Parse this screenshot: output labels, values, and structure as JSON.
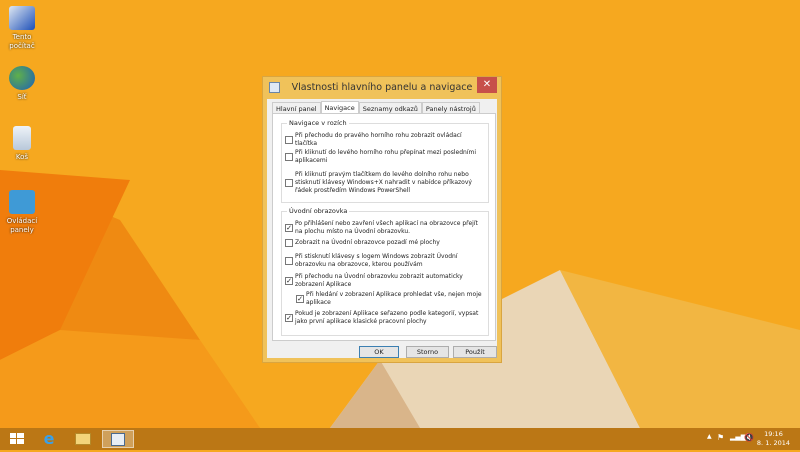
{
  "desktop": {
    "icons": [
      {
        "label": "Tento počítač",
        "icon": "computer-icon"
      },
      {
        "label": "Síť",
        "icon": "network-icon"
      },
      {
        "label": "Koš",
        "icon": "recycle-bin-icon"
      },
      {
        "label": "Ovládací panely",
        "icon": "control-panel-icon"
      }
    ]
  },
  "dialog": {
    "title": "Vlastnosti hlavního panelu a navigace",
    "close": "✕",
    "tabs": [
      "Hlavní panel",
      "Navigace",
      "Seznamy odkazů",
      "Panely nástrojů"
    ],
    "active_tab": "Navigace",
    "groups": [
      {
        "label": "Navigace v rozích",
        "options": [
          {
            "text": "Při přechodu do pravého horního rohu zobrazit ovládací tlačítka",
            "checked": false
          },
          {
            "text": "Při kliknutí do levého horního rohu přepínat mezi posledními aplikacemi",
            "checked": false
          },
          {
            "text": "Při kliknutí pravým tlačítkem do levého dolního rohu nebo stisknutí klávesy Windows+X nahradit v nabídce příkazový řádek prostředím Windows PowerShell",
            "checked": false
          }
        ]
      },
      {
        "label": "Úvodní obrazovka",
        "options": [
          {
            "text": "Po přihlášení nebo zavření všech aplikací na obrazovce přejít na plochu místo na Úvodní obrazovku.",
            "checked": true
          },
          {
            "text": "Zobrazit na Úvodní obrazovce pozadí mé plochy",
            "checked": false
          },
          {
            "text": "Při stisknutí klávesy s logem Windows zobrazit Úvodní obrazovku na obrazovce, kterou používám",
            "checked": false
          },
          {
            "text": "Při přechodu na Úvodní obrazovku zobrazit automaticky zobrazení Aplikace",
            "checked": true
          },
          {
            "text": "Při hledání v zobrazení Aplikace prohledat vše, nejen moje aplikace",
            "checked": true
          },
          {
            "text": "Pokud je zobrazení Aplikace seřazeno podle kategorií, vypsat jako první aplikace klasické pracovní plochy",
            "checked": true
          }
        ]
      }
    ],
    "buttons": {
      "ok": "OK",
      "cancel": "Storno",
      "apply": "Použít"
    }
  },
  "taskbar": {
    "clock": {
      "time": "19:16",
      "date": "8. 1. 2014"
    },
    "tray": [
      "chevron-up-icon",
      "flag-icon",
      "signal-icon",
      "volume-muted-icon"
    ]
  }
}
